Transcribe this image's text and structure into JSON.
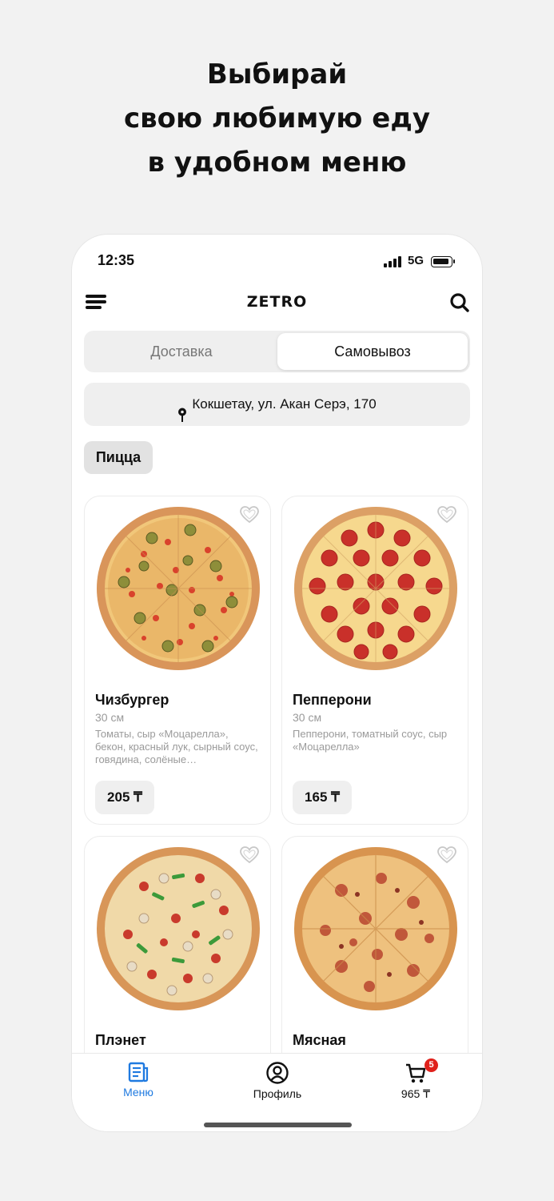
{
  "headline": [
    "Выбирай",
    "свою любимую еду",
    "в удобном меню"
  ],
  "status": {
    "time": "12:35",
    "network": "5G"
  },
  "header": {
    "brand": "ZETRO",
    "menu_icon": "hamburger-icon",
    "search_icon": "search-icon"
  },
  "delivery_toggle": {
    "options": [
      "Доставка",
      "Самовывоз"
    ],
    "selected": "Самовывоз"
  },
  "address": "Кокшетау, ул. Акан Серэ, 170",
  "category_chip": "Пицца",
  "products": [
    {
      "name": "Чизбургер",
      "size": "30 см",
      "description": "Томаты, сыр «Моцарелла», бекон, красный лук, сырный соус, говядина, солёные…",
      "price": "205 ₸"
    },
    {
      "name": "Пепперони",
      "size": "30 см",
      "description": "Пепперони, томатный соус, сыр «Моцарелла»",
      "price": "165 ₸"
    },
    {
      "name": "Плэнет"
    },
    {
      "name": "Мясная"
    }
  ],
  "tabbar": {
    "items": [
      {
        "label": "Меню",
        "icon": "menu-doc-icon",
        "active": true
      },
      {
        "label": "Профиль",
        "icon": "profile-icon",
        "active": false
      },
      {
        "label": "965 ₸",
        "icon": "cart-icon",
        "active": false,
        "badge": "5"
      }
    ]
  },
  "colors": {
    "accent": "#1f7ae0",
    "badge": "#e0211b",
    "background": "#f2f2f2"
  }
}
